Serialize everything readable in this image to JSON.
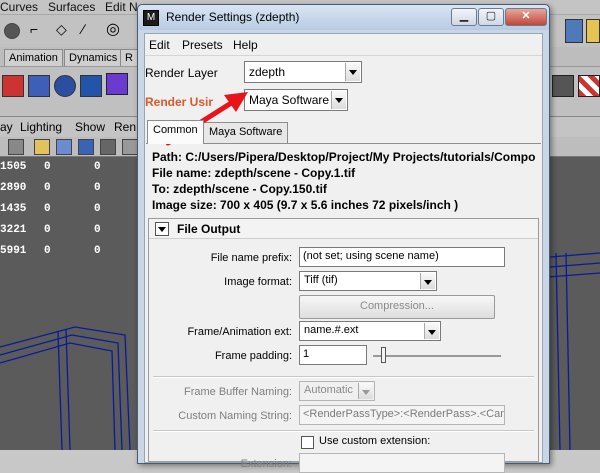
{
  "maya": {
    "menu": [
      "Curves",
      "Surfaces",
      "Edit N"
    ],
    "shelf_tabs": [
      "Animation",
      "Dynamics",
      "R"
    ],
    "panel_menu": [
      "Lighting",
      "Show",
      "Ren"
    ],
    "left_menu": "ay",
    "viewport_rows": [
      {
        "id": "1505",
        "a": "0",
        "b": "0"
      },
      {
        "id": "2890",
        "a": "0",
        "b": "0"
      },
      {
        "id": "1435",
        "a": "0",
        "b": "0"
      },
      {
        "id": "3221",
        "a": "0",
        "b": "0"
      },
      {
        "id": "5991",
        "a": "0",
        "b": "0"
      }
    ]
  },
  "dialog": {
    "title": "Render Settings (zdepth)",
    "icon": "maya-icon",
    "menu": [
      "Edit",
      "Presets",
      "Help"
    ],
    "render_layer_label": "Render Layer",
    "render_layer_value": "zdepth",
    "render_using_label": "Render Usir",
    "render_using_value": "Maya Software",
    "tabs": [
      "Common",
      "Maya Software"
    ],
    "info": {
      "path": "Path: C:/Users/Pipera/Desktop/Project/My Projects/tutorials/Compo",
      "file_name": "File name:   zdepth/scene - Copy.1.tif",
      "to": "To:            zdepth/scene - Copy.150.tif",
      "image_size": "Image size: 700 x 405 (9.7 x 5.6 inches 72 pixels/inch )"
    },
    "file_output": {
      "title": "File Output",
      "file_name_prefix_label": "File name prefix:",
      "file_name_prefix_value": "(not set; using scene name)",
      "image_format_label": "Image format:",
      "image_format_value": "Tiff (tif)",
      "compression_label": "Compression...",
      "frame_ext_label": "Frame/Animation ext:",
      "frame_ext_value": "name.#.ext",
      "frame_padding_label": "Frame padding:",
      "frame_padding_value": "1",
      "frame_buffer_label": "Frame Buffer Naming:",
      "frame_buffer_value": "Automatic",
      "custom_naming_label": "Custom Naming String:",
      "custom_naming_value": "<RenderPassType>:<RenderPass>.<Came",
      "use_custom_ext_label": "Use custom extension:",
      "extension_label": "Extension:"
    }
  },
  "colors": {
    "render_using_label": "#d85a2a",
    "annotation_arrow": "#e8141b"
  }
}
